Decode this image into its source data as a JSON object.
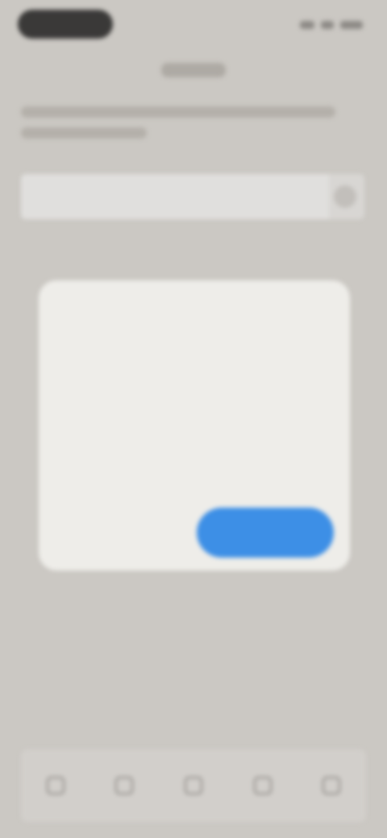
{
  "status_bar": {
    "time": "",
    "icons": [
      "signal-icon",
      "wifi-icon",
      "battery-icon"
    ]
  },
  "header": {
    "title": ""
  },
  "search": {
    "placeholder": "",
    "value": ""
  },
  "dialog": {
    "title": "",
    "body": "",
    "note": "",
    "secondary_label": "",
    "primary_label": ""
  },
  "tab_bar": {
    "items": [
      {
        "icon": "home-icon"
      },
      {
        "icon": "search-icon"
      },
      {
        "icon": "add-icon"
      },
      {
        "icon": "inbox-icon"
      },
      {
        "icon": "profile-icon"
      }
    ]
  },
  "colors": {
    "background": "#cbc8c3",
    "dialog": "#eeede9",
    "primary_button": "#3d8fe6"
  }
}
